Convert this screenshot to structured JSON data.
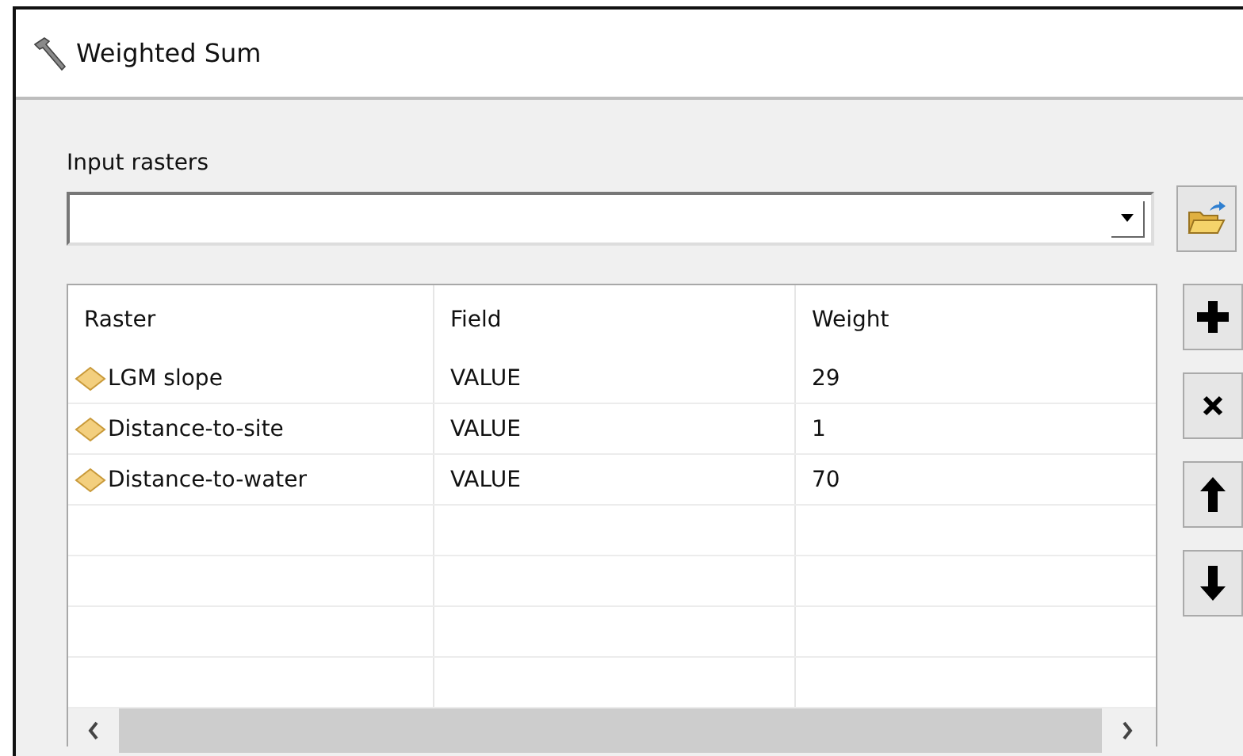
{
  "window": {
    "title": "Weighted Sum"
  },
  "input_rasters": {
    "label": "Input rasters"
  },
  "table": {
    "columns": [
      "Raster",
      "Field",
      "Weight"
    ],
    "rows": [
      {
        "raster": "LGM slope",
        "field": "VALUE",
        "weight": "29"
      },
      {
        "raster": "Distance-to-site",
        "field": "VALUE",
        "weight": "1"
      },
      {
        "raster": "Distance-to-water",
        "field": "VALUE",
        "weight": "70"
      }
    ]
  }
}
